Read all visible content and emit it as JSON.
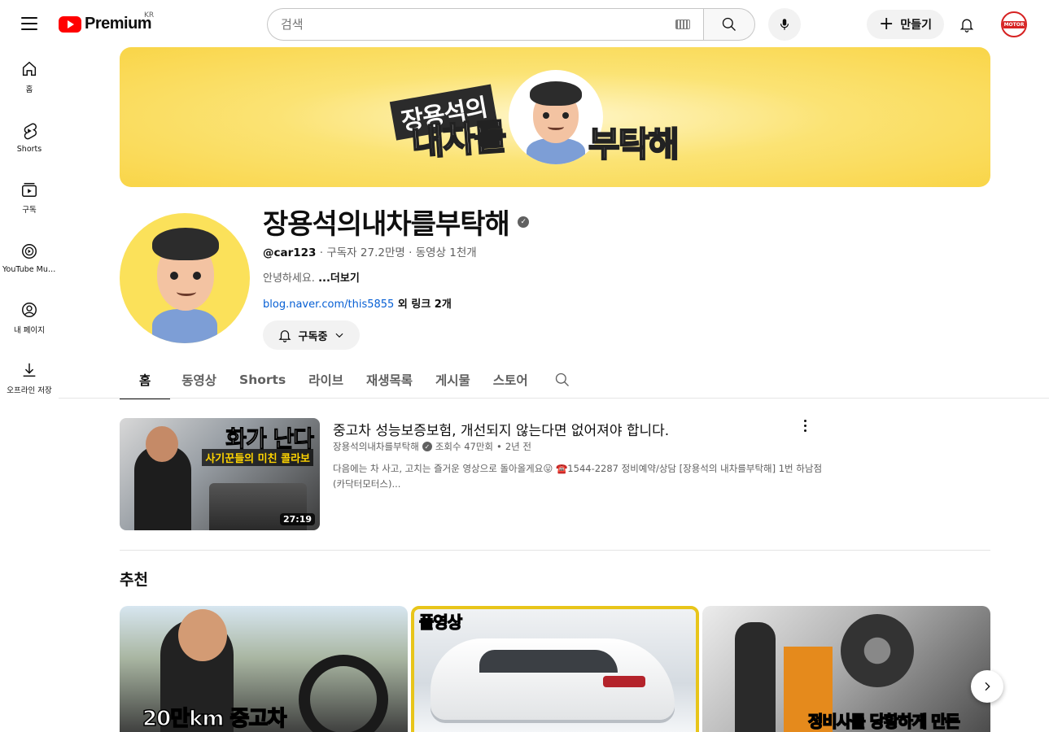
{
  "header": {
    "logo_text": "Premium",
    "logo_region": "KR",
    "search_placeholder": "검색",
    "create_label": "만들기",
    "avatar_text": "MOTOR"
  },
  "sidebar": {
    "items": [
      {
        "label": "홈",
        "icon": "home-icon"
      },
      {
        "label": "Shorts",
        "icon": "shorts-icon"
      },
      {
        "label": "구독",
        "icon": "subscriptions-icon"
      },
      {
        "label": "YouTube Music",
        "icon": "youtube-music-icon"
      },
      {
        "label": "내 페이지",
        "icon": "account-icon"
      },
      {
        "label": "오프라인 저장",
        "icon": "download-icon"
      }
    ]
  },
  "banner": {
    "line1": "장용석의",
    "line2": "내차를",
    "line3": "부탁해"
  },
  "channel": {
    "name": "장용석의내차를부탁해",
    "handle": "@car123",
    "subscribers": "구독자 27.2만명",
    "videos": "동영상 1천개",
    "description": "안녕하세요. ",
    "more": "...더보기",
    "link": "blog.naver.com/this5855",
    "link_extra": " 외 링크 2개",
    "subscribe_label": "구독중"
  },
  "tabs": [
    "홈",
    "동영상",
    "Shorts",
    "라이브",
    "재생목록",
    "게시물",
    "스토어"
  ],
  "featured": {
    "title": "중고차 성능보증보험, 개선되지 않는다면 없어져야 합니다.",
    "channel": "장용석의내차를부탁해",
    "views": "조회수 47만회",
    "age": "2년 전",
    "description": "다음에는 차 사고, 고치는 즐거운 영상으로 돌아올게요😛 ☎️1544-2287 정비예약/상담 [장용석의 내차를부탁해] 1번 하남점 (카닥터모터스)...",
    "duration": "27:19",
    "thumb_text1": "화가 난다",
    "thumb_text2": "사기꾼들의 미친 콜라보"
  },
  "recommended": {
    "title": "추천",
    "items": [
      {
        "caption": "20만km 중고차"
      },
      {
        "caption": "풀영상"
      },
      {
        "caption": "정비사를 당황하게 만든"
      }
    ]
  },
  "colors": {
    "brand_red": "#ff0000",
    "link_blue": "#065fd4",
    "banner_yellow": "#f9d548"
  }
}
